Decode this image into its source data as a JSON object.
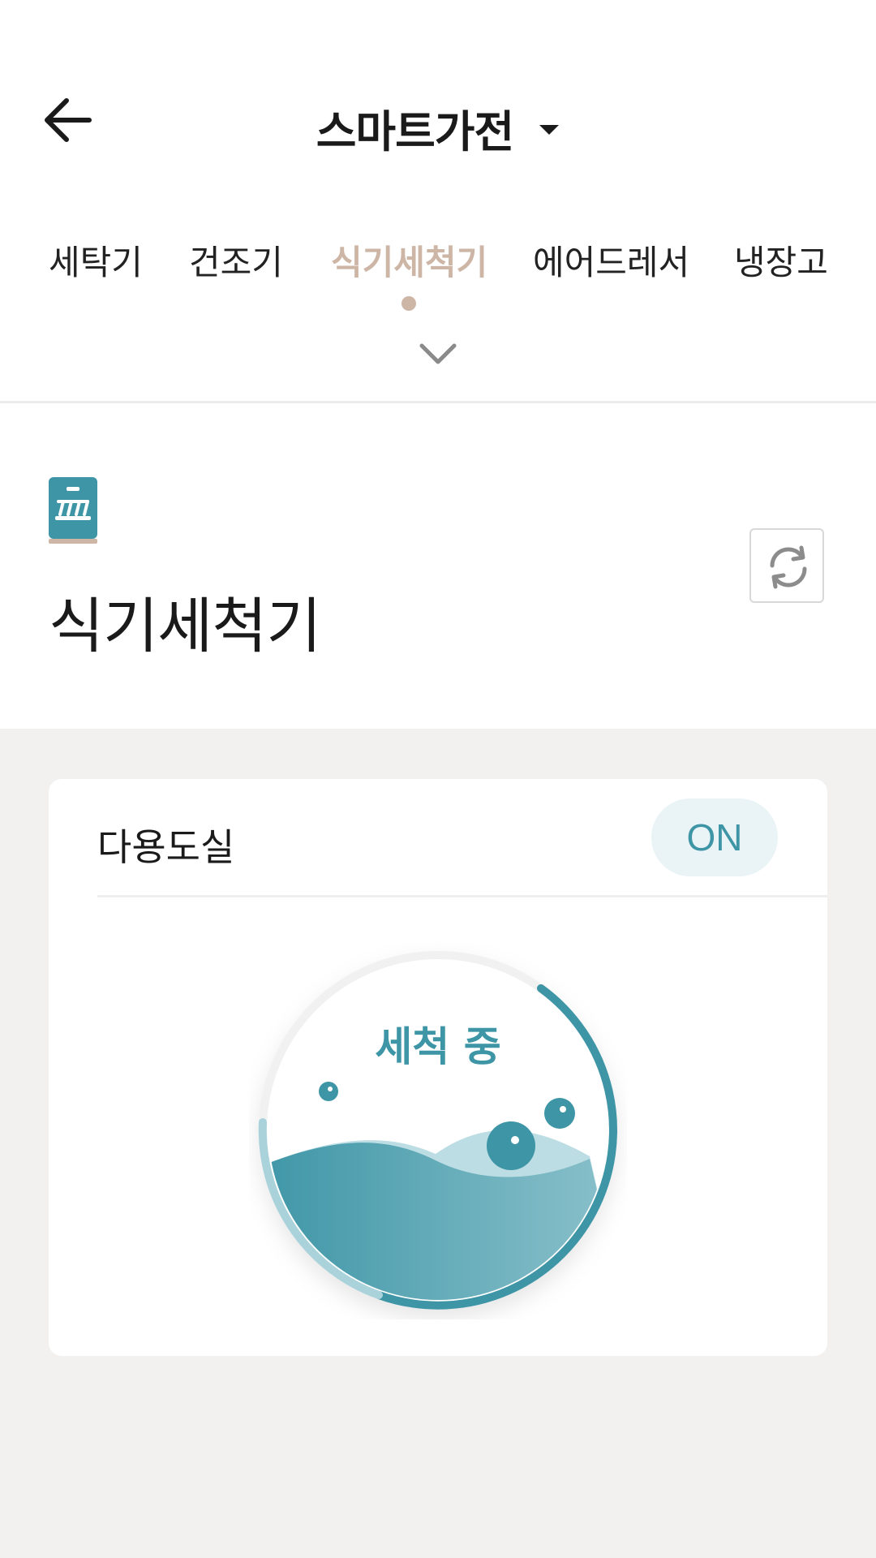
{
  "header": {
    "title": "스마트가전"
  },
  "tabs": [
    {
      "label": "세탁기"
    },
    {
      "label": "건조기"
    },
    {
      "label": "식기세척기"
    },
    {
      "label": "에어드레서"
    },
    {
      "label": "냉장고"
    }
  ],
  "active_tab_index": 2,
  "device": {
    "name": "식기세척기",
    "icon": "dishwasher-icon"
  },
  "room": {
    "name": "다용도실",
    "power": "ON"
  },
  "status": {
    "label": "세척 중"
  },
  "colors": {
    "accent_teal": "#3d95a6",
    "accent_beige": "#cdb6a6",
    "background": "#f2f1ef"
  }
}
